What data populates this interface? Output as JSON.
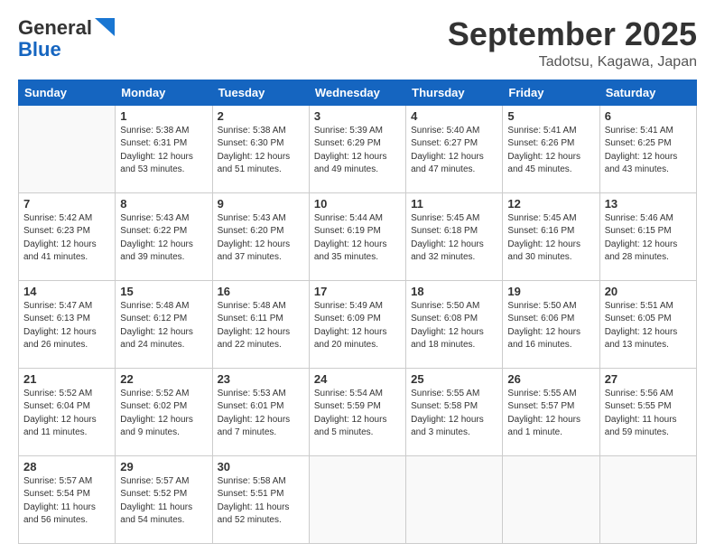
{
  "header": {
    "logo_line1": "General",
    "logo_line2": "Blue",
    "month": "September 2025",
    "location": "Tadotsu, Kagawa, Japan"
  },
  "weekdays": [
    "Sunday",
    "Monday",
    "Tuesday",
    "Wednesday",
    "Thursday",
    "Friday",
    "Saturday"
  ],
  "weeks": [
    [
      {
        "day": "",
        "info": ""
      },
      {
        "day": "1",
        "info": "Sunrise: 5:38 AM\nSunset: 6:31 PM\nDaylight: 12 hours\nand 53 minutes."
      },
      {
        "day": "2",
        "info": "Sunrise: 5:38 AM\nSunset: 6:30 PM\nDaylight: 12 hours\nand 51 minutes."
      },
      {
        "day": "3",
        "info": "Sunrise: 5:39 AM\nSunset: 6:29 PM\nDaylight: 12 hours\nand 49 minutes."
      },
      {
        "day": "4",
        "info": "Sunrise: 5:40 AM\nSunset: 6:27 PM\nDaylight: 12 hours\nand 47 minutes."
      },
      {
        "day": "5",
        "info": "Sunrise: 5:41 AM\nSunset: 6:26 PM\nDaylight: 12 hours\nand 45 minutes."
      },
      {
        "day": "6",
        "info": "Sunrise: 5:41 AM\nSunset: 6:25 PM\nDaylight: 12 hours\nand 43 minutes."
      }
    ],
    [
      {
        "day": "7",
        "info": "Sunrise: 5:42 AM\nSunset: 6:23 PM\nDaylight: 12 hours\nand 41 minutes."
      },
      {
        "day": "8",
        "info": "Sunrise: 5:43 AM\nSunset: 6:22 PM\nDaylight: 12 hours\nand 39 minutes."
      },
      {
        "day": "9",
        "info": "Sunrise: 5:43 AM\nSunset: 6:20 PM\nDaylight: 12 hours\nand 37 minutes."
      },
      {
        "day": "10",
        "info": "Sunrise: 5:44 AM\nSunset: 6:19 PM\nDaylight: 12 hours\nand 35 minutes."
      },
      {
        "day": "11",
        "info": "Sunrise: 5:45 AM\nSunset: 6:18 PM\nDaylight: 12 hours\nand 32 minutes."
      },
      {
        "day": "12",
        "info": "Sunrise: 5:45 AM\nSunset: 6:16 PM\nDaylight: 12 hours\nand 30 minutes."
      },
      {
        "day": "13",
        "info": "Sunrise: 5:46 AM\nSunset: 6:15 PM\nDaylight: 12 hours\nand 28 minutes."
      }
    ],
    [
      {
        "day": "14",
        "info": "Sunrise: 5:47 AM\nSunset: 6:13 PM\nDaylight: 12 hours\nand 26 minutes."
      },
      {
        "day": "15",
        "info": "Sunrise: 5:48 AM\nSunset: 6:12 PM\nDaylight: 12 hours\nand 24 minutes."
      },
      {
        "day": "16",
        "info": "Sunrise: 5:48 AM\nSunset: 6:11 PM\nDaylight: 12 hours\nand 22 minutes."
      },
      {
        "day": "17",
        "info": "Sunrise: 5:49 AM\nSunset: 6:09 PM\nDaylight: 12 hours\nand 20 minutes."
      },
      {
        "day": "18",
        "info": "Sunrise: 5:50 AM\nSunset: 6:08 PM\nDaylight: 12 hours\nand 18 minutes."
      },
      {
        "day": "19",
        "info": "Sunrise: 5:50 AM\nSunset: 6:06 PM\nDaylight: 12 hours\nand 16 minutes."
      },
      {
        "day": "20",
        "info": "Sunrise: 5:51 AM\nSunset: 6:05 PM\nDaylight: 12 hours\nand 13 minutes."
      }
    ],
    [
      {
        "day": "21",
        "info": "Sunrise: 5:52 AM\nSunset: 6:04 PM\nDaylight: 12 hours\nand 11 minutes."
      },
      {
        "day": "22",
        "info": "Sunrise: 5:52 AM\nSunset: 6:02 PM\nDaylight: 12 hours\nand 9 minutes."
      },
      {
        "day": "23",
        "info": "Sunrise: 5:53 AM\nSunset: 6:01 PM\nDaylight: 12 hours\nand 7 minutes."
      },
      {
        "day": "24",
        "info": "Sunrise: 5:54 AM\nSunset: 5:59 PM\nDaylight: 12 hours\nand 5 minutes."
      },
      {
        "day": "25",
        "info": "Sunrise: 5:55 AM\nSunset: 5:58 PM\nDaylight: 12 hours\nand 3 minutes."
      },
      {
        "day": "26",
        "info": "Sunrise: 5:55 AM\nSunset: 5:57 PM\nDaylight: 12 hours\nand 1 minute."
      },
      {
        "day": "27",
        "info": "Sunrise: 5:56 AM\nSunset: 5:55 PM\nDaylight: 11 hours\nand 59 minutes."
      }
    ],
    [
      {
        "day": "28",
        "info": "Sunrise: 5:57 AM\nSunset: 5:54 PM\nDaylight: 11 hours\nand 56 minutes."
      },
      {
        "day": "29",
        "info": "Sunrise: 5:57 AM\nSunset: 5:52 PM\nDaylight: 11 hours\nand 54 minutes."
      },
      {
        "day": "30",
        "info": "Sunrise: 5:58 AM\nSunset: 5:51 PM\nDaylight: 11 hours\nand 52 minutes."
      },
      {
        "day": "",
        "info": ""
      },
      {
        "day": "",
        "info": ""
      },
      {
        "day": "",
        "info": ""
      },
      {
        "day": "",
        "info": ""
      }
    ]
  ]
}
